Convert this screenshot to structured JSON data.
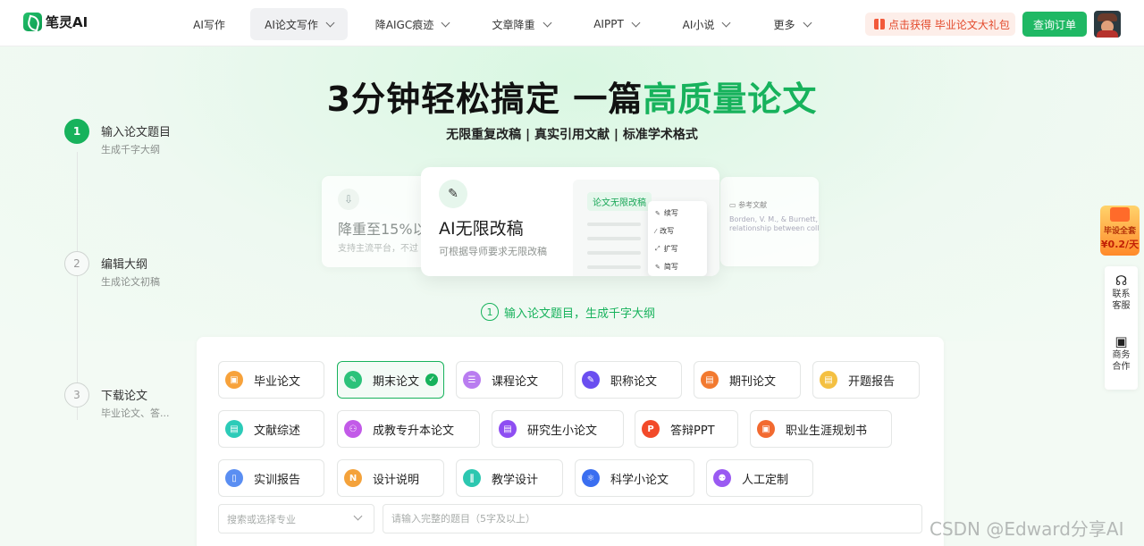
{
  "brand": {
    "name": "笔灵AI"
  },
  "nav": [
    {
      "label": "AI写作",
      "dropdown": false,
      "active": false
    },
    {
      "label": "AI论文写作",
      "dropdown": true,
      "active": true
    },
    {
      "label": "降AIGC痕迹",
      "dropdown": true,
      "active": false
    },
    {
      "label": "文章降重",
      "dropdown": true,
      "active": false
    },
    {
      "label": "AIPPT",
      "dropdown": true,
      "active": false
    },
    {
      "label": "AI小说",
      "dropdown": true,
      "active": false
    },
    {
      "label": "更多",
      "dropdown": true,
      "active": false
    }
  ],
  "header": {
    "promo": "点击获得 毕业论文大礼包",
    "order_button": "查询订单"
  },
  "hero": {
    "title_main": "3分钟轻松搞定 一篇",
    "title_highlight": "高质量论文",
    "subtitle": "无限重复改稿 | 真实引用文献 | 标准学术格式"
  },
  "steps": [
    {
      "num": "1",
      "title": "输入论文题目",
      "desc": "生成千字大纲",
      "active": true
    },
    {
      "num": "2",
      "title": "编辑大纲",
      "desc": "生成论文初稿",
      "active": false
    },
    {
      "num": "3",
      "title": "下载论文",
      "desc": "毕业论文、答...",
      "active": false
    }
  ],
  "feature_cards": {
    "left": {
      "title": "降重至15%以",
      "desc": "支持主流平台，不过"
    },
    "main": {
      "title": "AI无限改稿",
      "desc": "可根据导师要求无限改稿",
      "tag": "论文无限改稿",
      "menu": [
        "续写",
        "改写",
        "扩写",
        "简写"
      ]
    },
    "right": {
      "header": "参考文献",
      "line1": "Borden, V. M., & Burnett, A. W.",
      "line2": "relationship between college ..."
    }
  },
  "hint": {
    "num": "1",
    "text": "输入论文题目，生成千字大纲"
  },
  "paper_types": [
    {
      "label": "毕业论文",
      "icon": "graduation-thesis-icon",
      "color": "#f7a23b",
      "selected": false
    },
    {
      "label": "期末论文",
      "icon": "final-paper-icon",
      "color": "#2cc27a",
      "selected": true
    },
    {
      "label": "课程论文",
      "icon": "course-paper-icon",
      "color": "#b97cf0",
      "selected": false
    },
    {
      "label": "职称论文",
      "icon": "title-paper-icon",
      "color": "#6a4ef0",
      "selected": false
    },
    {
      "label": "期刊论文",
      "icon": "journal-paper-icon",
      "color": "#f27a30",
      "selected": false
    },
    {
      "label": "开题报告",
      "icon": "proposal-report-icon",
      "color": "#f4c042",
      "selected": false
    },
    {
      "label": "文献综述",
      "icon": "literature-review-icon",
      "color": "#2ccbb8",
      "selected": false
    },
    {
      "label": "成教专升本论文",
      "icon": "adult-education-icon",
      "color": "#c25ae8",
      "selected": false
    },
    {
      "label": "研究生小论文",
      "icon": "graduate-paper-icon",
      "color": "#8e4ef2",
      "selected": false
    },
    {
      "label": "答辩PPT",
      "icon": "defense-ppt-icon",
      "color": "#f24a2a",
      "selected": false
    },
    {
      "label": "职业生涯规划书",
      "icon": "career-plan-icon",
      "color": "#f26a30",
      "selected": false
    },
    {
      "label": "实训报告",
      "icon": "training-report-icon",
      "color": "#5a8ef2",
      "selected": false
    },
    {
      "label": "设计说明",
      "icon": "design-note-icon",
      "color": "#f4a23b",
      "selected": false
    },
    {
      "label": "教学设计",
      "icon": "teaching-design-icon",
      "color": "#2cc7b0",
      "selected": false
    },
    {
      "label": "科学小论文",
      "icon": "science-paper-icon",
      "color": "#3a6ef0",
      "selected": false
    },
    {
      "label": "人工定制",
      "icon": "custom-service-icon",
      "color": "#9a5af2",
      "selected": false
    }
  ],
  "inputs": {
    "major_placeholder": "搜索或选择专业",
    "topic_placeholder": "请输入完整的题目（5字及以上）"
  },
  "side": {
    "promo_line1": "毕设全套",
    "promo_line2": "¥0.2/天",
    "contact": "联系客服",
    "business": "商务合作"
  },
  "watermark": "CSDN @Edward分享AI"
}
